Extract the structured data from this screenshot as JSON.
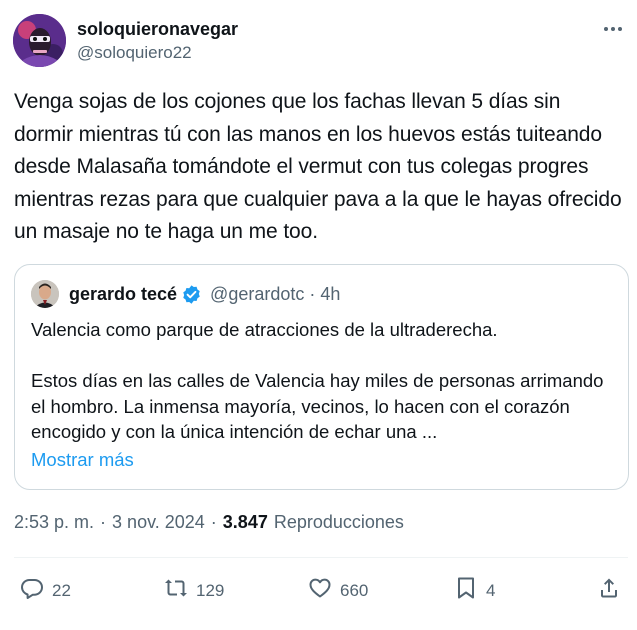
{
  "author": {
    "name": "soloquieronavegar",
    "handle": "@soloquiero22"
  },
  "tweet": {
    "text": "Venga sojas de los cojones que los fachas llevan 5 días sin dormir mientras tú con las manos en los huevos estás tuiteando desde Malasaña tomándote el vermut con tus colegas progres mientras rezas para que cualquier pava a la que le hayas ofrecido un masaje no te haga un me too."
  },
  "quote": {
    "name": "gerardo tecé",
    "handle": "@gerardotc",
    "dot": "·",
    "time": "4h",
    "paragraph1": "Valencia como parque de atracciones de la ultraderecha.",
    "paragraph2": "Estos días en las calles de Valencia hay miles de personas arrimando el hombro. La inmensa mayoría, vecinos, lo hacen con el corazón encogido y con la única intención de echar una ...",
    "show_more": "Mostrar más"
  },
  "meta": {
    "time": "2:53 p. m.",
    "dot": "·",
    "date": "3 nov. 2024",
    "views_count": "3.847",
    "views_label": "Reproducciones"
  },
  "actions": {
    "replies": "22",
    "reposts": "129",
    "likes": "660",
    "bookmarks": "4"
  },
  "colors": {
    "text": "#0f1419",
    "secondary": "#536471",
    "link": "#1d9bf0",
    "border": "#cfd9de",
    "divider": "#eff3f4"
  },
  "icons": {
    "more": "more-dots-icon",
    "verified": "verified-badge-icon",
    "reply": "reply-bubble-icon",
    "repost": "repost-arrows-icon",
    "like": "heart-icon",
    "bookmark": "bookmark-icon",
    "share": "share-upload-icon"
  }
}
